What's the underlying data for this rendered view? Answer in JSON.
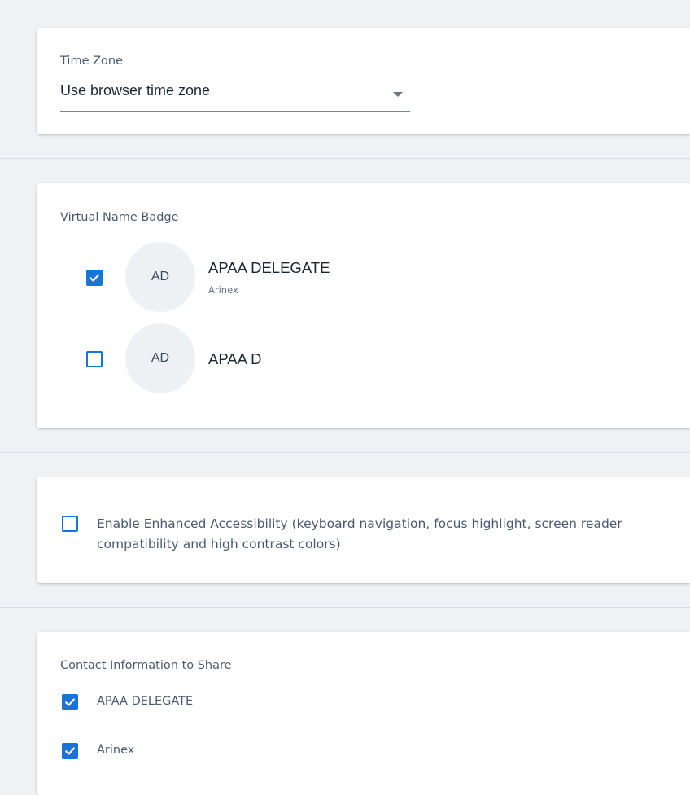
{
  "timezone": {
    "label": "Time Zone",
    "value": "Use browser time zone"
  },
  "badge": {
    "label": "Virtual Name Badge",
    "options": [
      {
        "initials": "AD",
        "name": "APAA DELEGATE",
        "org": "Arinex",
        "checked": true
      },
      {
        "initials": "AD",
        "name": "APAA D",
        "org": "",
        "checked": false
      }
    ]
  },
  "accessibility": {
    "label": "Enable Enhanced Accessibility (keyboard navigation, focus highlight, screen reader compatibility and high contrast colors)",
    "checked": false
  },
  "contact": {
    "label": "Contact Information to Share",
    "items": [
      {
        "label": "APAA DELEGATE",
        "checked": true
      },
      {
        "label": "Arinex",
        "checked": true
      }
    ]
  },
  "colors": {
    "accent": "#1a73d9",
    "background": "#eff2f5",
    "card": "#ffffff"
  }
}
